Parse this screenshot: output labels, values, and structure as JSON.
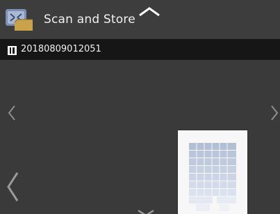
{
  "header": {
    "app_icon": "scan-and-store-icon",
    "title": "Scan and Store",
    "up_icon": "chevron-up-icon"
  },
  "file_bar": {
    "file_icon": "document-icon",
    "file_name": "20180809012051"
  },
  "navigation": {
    "prev_small_icon": "chevron-left-icon",
    "next_small_icon": "chevron-right-icon",
    "prev_large_icon": "chevron-left-icon",
    "down_icon": "chevron-down-icon"
  },
  "preview": {
    "thumbnail_icon": "document-thumbnail"
  },
  "colors": {
    "background": "#3a3a3a",
    "file_bar": "#161616",
    "text": "#f0f0f0",
    "preview_paper": "#f7f7f7",
    "preview_tint": "#b8c8e0"
  }
}
